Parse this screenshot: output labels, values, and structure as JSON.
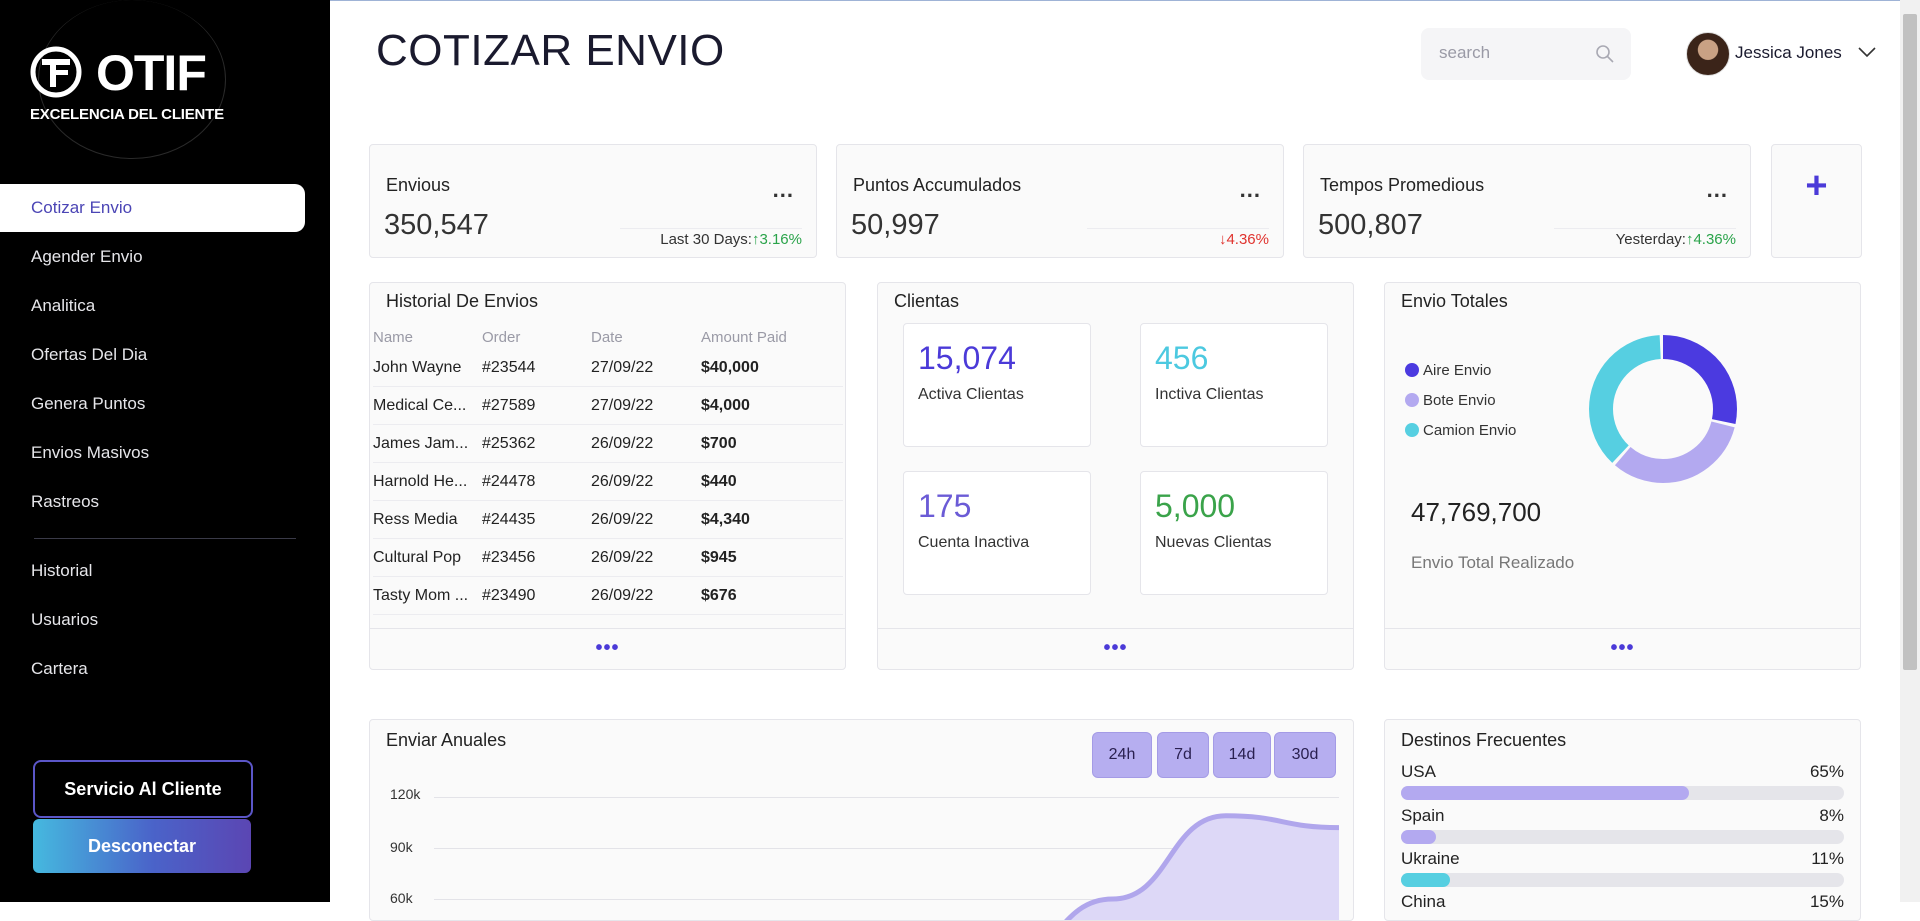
{
  "sidebar": {
    "logo_text": "OTIF",
    "logo_subtitle": "EXCELENCIA DEL CLIENTE",
    "items": [
      {
        "label": "Cotizar Envio",
        "active": true
      },
      {
        "label": "Agender Envio"
      },
      {
        "label": "Analitica"
      },
      {
        "label": "Ofertas Del Dia"
      },
      {
        "label": "Genera Puntos"
      },
      {
        "label": "Envios Masivos"
      },
      {
        "label": "Rastreos"
      }
    ],
    "items2": [
      {
        "label": "Historial"
      },
      {
        "label": "Usuarios"
      },
      {
        "label": "Cartera"
      }
    ],
    "service_button": "Servicio Al Cliente",
    "logout_button": "Desconectar"
  },
  "header": {
    "title": "COTIZAR ENVIO",
    "search_placeholder": "search",
    "user_name": "Jessica Jones"
  },
  "stats": [
    {
      "title": "Envious",
      "value": "350,547",
      "foot_label": "Last 30 Days:",
      "change": "↑3.16%",
      "trend": "up"
    },
    {
      "title": "Puntos Accumulados",
      "value": "50,997",
      "foot_label": "",
      "change": "↓4.36%",
      "trend": "down"
    },
    {
      "title": "Tempos Promedious",
      "value": "500,807",
      "foot_label": "Yesterday:",
      "change": "↑4.36%",
      "trend": "up"
    }
  ],
  "stat_dots": "...",
  "add_symbol": "+",
  "history": {
    "title": "Historial De Envios",
    "columns": [
      "Name",
      "Order",
      "Date",
      "Amount Paid"
    ],
    "rows": [
      [
        "John Wayne",
        "#23544",
        "27/09/22",
        "$40,000"
      ],
      [
        "Medical Ce...",
        "#27589",
        "27/09/22",
        "$4,000"
      ],
      [
        "James Jam...",
        "#25362",
        "26/09/22",
        "$700"
      ],
      [
        "Harnold He...",
        "#24478",
        "26/09/22",
        "$440"
      ],
      [
        "Ress Media",
        "#24435",
        "26/09/22",
        "$4,340"
      ],
      [
        "Cultural Pop",
        "#23456",
        "26/09/22",
        "$945"
      ],
      [
        "Tasty Mom ...",
        "#23490",
        "26/09/22",
        "$676"
      ]
    ],
    "more": "•••"
  },
  "clients": {
    "title": "Clientas",
    "tiles": [
      {
        "value": "15,074",
        "label": "Activa Clientas",
        "color": "#4b3ad8"
      },
      {
        "value": "456",
        "label": "Inctiva Clientas",
        "color": "#4cc9e0"
      },
      {
        "value": "175",
        "label": "Cuenta Inactiva",
        "color": "#6b5bd6"
      },
      {
        "value": "5,000",
        "label": "Nuevas Clientas",
        "color": "#3aa34a"
      }
    ],
    "more": "•••"
  },
  "totals": {
    "title": "Envio Totales",
    "legend": [
      {
        "label": "Aire Envio",
        "color": "#4b3ae0"
      },
      {
        "label": "Bote Envio",
        "color": "#b3a9f0"
      },
      {
        "label": "Camion Envio",
        "color": "#56cfe1"
      }
    ],
    "value": "47,769,700",
    "value_label": "Envio Total Realizado",
    "more": "•••"
  },
  "chart_data": [
    {
      "type": "pie",
      "title": "Envio Totales",
      "categories": [
        "Aire Envio",
        "Bote Envio",
        "Camion Envio"
      ],
      "values": [
        29,
        33,
        38
      ],
      "colors": [
        "#4b3ae0",
        "#b3a9f0",
        "#56cfe1"
      ]
    },
    {
      "type": "area",
      "title": "Enviar Anuales",
      "yticks": [
        "120k",
        "90k",
        "60k"
      ],
      "ylim": [
        60000,
        120000
      ],
      "x": [
        0,
        1,
        2,
        3,
        4,
        5,
        6,
        7,
        8
      ],
      "values": [
        20000,
        20000,
        20000,
        20000,
        20000,
        20000,
        60000,
        109000,
        102000
      ],
      "colors": {
        "fill": "#ddd8f7",
        "line": "#b0a6ec"
      },
      "ranges": [
        "24h",
        "7d",
        "14d",
        "30d"
      ]
    }
  ],
  "destinations": {
    "title": "Destinos Frecuentes",
    "items": [
      {
        "name": "USA",
        "pct": "65%",
        "value": 0.65,
        "color": "#b3a9f0"
      },
      {
        "name": "Spain",
        "pct": "8%",
        "value": 0.08,
        "color": "#b3a9f0"
      },
      {
        "name": "Ukraine",
        "pct": "11%",
        "value": 0.11,
        "color": "#56cfe1"
      },
      {
        "name": "China",
        "pct": "15%",
        "value": 0.15,
        "color": "#b3a9f0"
      }
    ]
  }
}
